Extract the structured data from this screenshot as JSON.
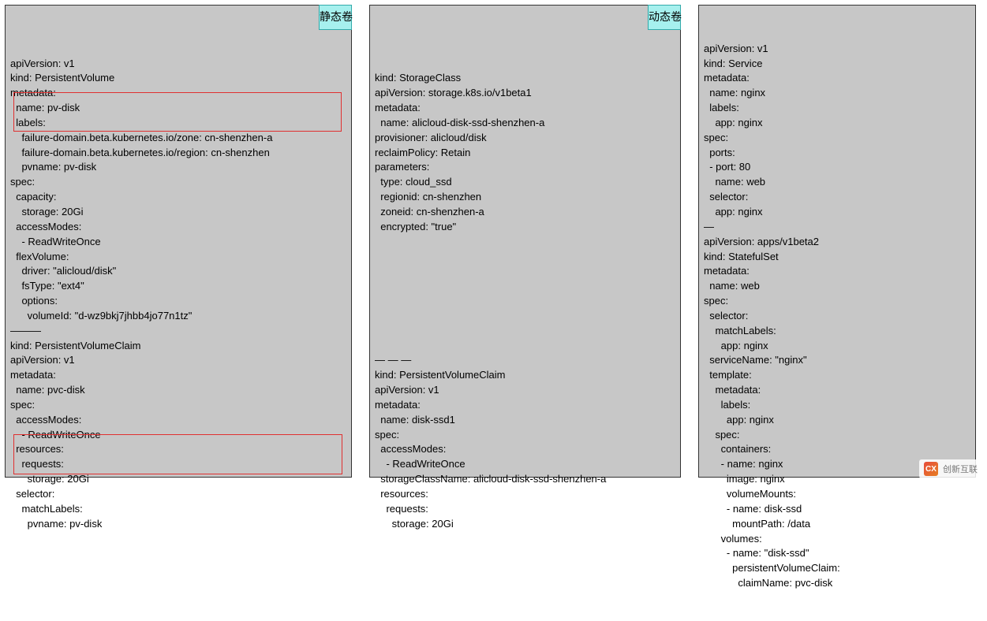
{
  "panel1": {
    "badge": "静态卷",
    "lines": [
      "apiVersion: v1",
      "kind: PersistentVolume",
      "metadata:",
      "  name: pv-disk",
      "  labels:",
      "    failure-domain.beta.kubernetes.io/zone: cn-shenzhen-a",
      "    failure-domain.beta.kubernetes.io/region: cn-shenzhen",
      "    pvname: pv-disk",
      "spec:",
      "  capacity:",
      "    storage: 20Gi",
      "  accessModes:",
      "    - ReadWriteOnce",
      "  flexVolume:",
      "    driver: \"alicloud/disk\"",
      "    fsType: \"ext4\"",
      "    options:",
      "      volumeId: \"d-wz9bkj7jhbb4jo77n1tz\"",
      "———",
      "kind: PersistentVolumeClaim",
      "apiVersion: v1",
      "metadata:",
      "  name: pvc-disk",
      "spec:",
      "  accessModes:",
      "    - ReadWriteOnce",
      "  resources:",
      "    requests:",
      "      storage: 20Gi",
      "  selector:",
      "    matchLabels:",
      "      pvname: pv-disk"
    ]
  },
  "panel2": {
    "badge": "动态卷",
    "lines": [
      "",
      "kind: StorageClass",
      "apiVersion: storage.k8s.io/v1beta1",
      "metadata:",
      "  name: alicloud-disk-ssd-shenzhen-a",
      "provisioner: alicloud/disk",
      "reclaimPolicy: Retain",
      "parameters:",
      "  type: cloud_ssd",
      "  regionid: cn-shenzhen",
      "  zoneid: cn-shenzhen-a",
      "  encrypted: \"true\"",
      "",
      "",
      "",
      "",
      "",
      "",
      "",
      "",
      "— — —",
      "kind: PersistentVolumeClaim",
      "apiVersion: v1",
      "metadata:",
      "  name: disk-ssd1",
      "spec:",
      "  accessModes:",
      "    - ReadWriteOnce",
      "  storageClassName: alicloud-disk-ssd-shenzhen-a",
      "  resources:",
      "    requests:",
      "      storage: 20Gi"
    ]
  },
  "panel3": {
    "lines": [
      "apiVersion: v1",
      "kind: Service",
      "metadata:",
      "  name: nginx",
      "  labels:",
      "    app: nginx",
      "spec:",
      "  ports:",
      "  - port: 80",
      "    name: web",
      "  selector:",
      "    app: nginx",
      "—",
      "apiVersion: apps/v1beta2",
      "kind: StatefulSet",
      "metadata:",
      "  name: web",
      "spec:",
      "  selector:",
      "    matchLabels:",
      "      app: nginx",
      "  serviceName: \"nginx\"",
      "  template:",
      "    metadata:",
      "      labels:",
      "        app: nginx",
      "    spec:",
      "      containers:",
      "      - name: nginx",
      "        image: nginx",
      "        volumeMounts:",
      "        - name: disk-ssd",
      "          mountPath: /data",
      "      volumes:",
      "        - name: \"disk-ssd\"",
      "          persistentVolumeClaim:",
      "            claimName: pvc-disk"
    ]
  },
  "watermark": "创新互联"
}
